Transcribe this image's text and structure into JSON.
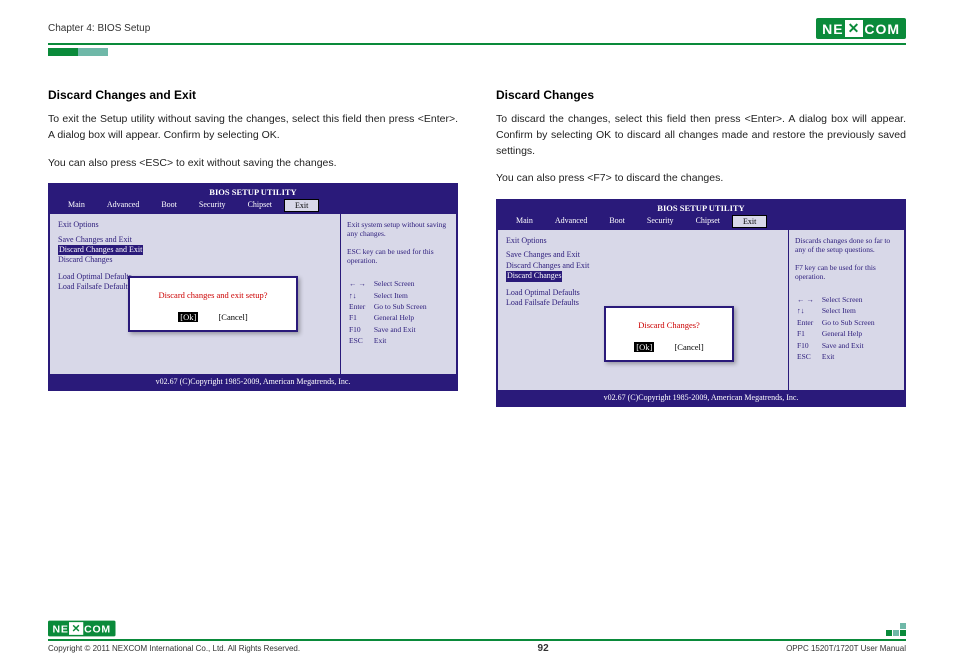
{
  "header": {
    "chapter": "Chapter 4: BIOS Setup",
    "brand": "NEXCOM"
  },
  "left": {
    "title": "Discard Changes and Exit",
    "p1": "To exit the Setup utility without saving the changes, select this field then press <Enter>. A dialog box will appear. Confirm by selecting OK.",
    "p2": "You can also press <ESC> to exit without saving the changes."
  },
  "right": {
    "title": "Discard Changes",
    "p1": "To discard the changes, select this field then press <Enter>. A dialog box will appear. Confirm by selecting OK to discard all changes made and restore the previously saved settings.",
    "p2": "You can also press <F7> to discard the changes."
  },
  "bios": {
    "title": "BIOS SETUP UTILITY",
    "tabs": [
      "Main",
      "Advanced",
      "Boot",
      "Security",
      "Chipset",
      "Exit"
    ],
    "opts_title": "Exit Options",
    "opts1": [
      "Save Changes and Exit",
      "Discard Changes and Exit",
      "Discard Changes"
    ],
    "opts2": [
      "Load Optimal Defaults",
      "Load Failsafe Defaults"
    ],
    "help_left": "Exit system setup without saving any changes.\n\nESC key can be used for this operation.",
    "help_right": "Discards changes done so far to any of the setup questions.\n\nF7 key can be used for this operation.",
    "keys": [
      [
        "← →",
        "Select Screen"
      ],
      [
        "↑↓",
        "Select Item"
      ],
      [
        "Enter",
        "Go to Sub Screen"
      ],
      [
        "F1",
        "General Help"
      ],
      [
        "F10",
        "Save and Exit"
      ],
      [
        "ESC",
        "Exit"
      ]
    ],
    "footer": "v02.67 (C)Copyright 1985-2009, American Megatrends, Inc."
  },
  "dialog1": {
    "msg": "Discard changes and exit setup?",
    "ok": "[Ok]",
    "cancel": "[Cancel]"
  },
  "dialog2": {
    "msg": "Discard Changes?",
    "ok": "[Ok]",
    "cancel": "[Cancel]"
  },
  "footer": {
    "copyright": "Copyright © 2011 NEXCOM International Co., Ltd. All Rights Reserved.",
    "page": "92",
    "manual": "OPPC 1520T/1720T User Manual"
  }
}
